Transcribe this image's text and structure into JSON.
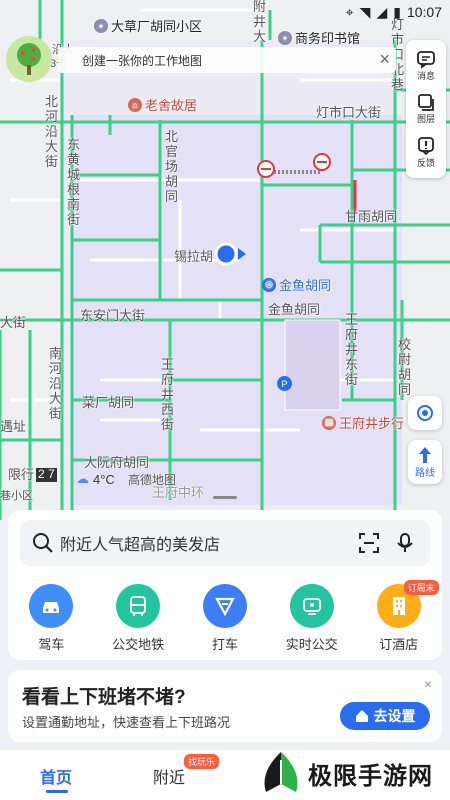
{
  "status": {
    "time": "10:07"
  },
  "banner": {
    "text": "创建一张你的工作地图",
    "close": "×"
  },
  "tools": [
    {
      "label": "消息",
      "icon": "message-icon"
    },
    {
      "label": "图层",
      "icon": "layers-icon"
    },
    {
      "label": "反馈",
      "icon": "feedback-icon"
    }
  ],
  "route_label": "路线",
  "map": {
    "labels": [
      {
        "text": "大草厂胡同小区",
        "kind": "poi"
      },
      {
        "text": "商务印书馆",
        "kind": "poi"
      },
      {
        "text": "老舍故居",
        "kind": "poi"
      },
      {
        "text": "金鱼胡同",
        "kind": "poi"
      },
      {
        "text": "王府井步行",
        "kind": "poi"
      },
      {
        "text": "灯市口大街"
      },
      {
        "text": "甘雨胡同"
      },
      {
        "text": "锡拉胡"
      },
      {
        "text": "东安门大街"
      },
      {
        "text": "金鱼胡同"
      },
      {
        "text": "菜厂胡同"
      },
      {
        "text": "大阮府胡同"
      },
      {
        "text": "王府中环"
      },
      {
        "text": "大街"
      },
      {
        "text": "限行"
      },
      {
        "text": "2 7"
      },
      {
        "text": "遇址"
      },
      {
        "text": "巷小区"
      },
      {
        "text": "北河沿大街"
      },
      {
        "text": "东黄城根南街"
      },
      {
        "text": "北官场胡同"
      },
      {
        "text": "南河沿大街"
      },
      {
        "text": "王府井西街"
      },
      {
        "text": "王府井东街"
      },
      {
        "text": "校尉胡同"
      },
      {
        "text": "灯市口北巷"
      },
      {
        "text": "附井大"
      },
      {
        "text": "沿大"
      },
      {
        "text": "3号"
      }
    ],
    "weather": {
      "temp": "4°C"
    },
    "watermark": "高德地图"
  },
  "search": {
    "placeholder": "附近人气超高的美发店"
  },
  "shortcuts": [
    {
      "label": "驾车",
      "color": "#3d8ef5",
      "icon": "car-icon"
    },
    {
      "label": "公交地铁",
      "color": "#23c4a0",
      "icon": "bus-icon"
    },
    {
      "label": "打车",
      "color": "#3d7ef5",
      "icon": "taxi-icon"
    },
    {
      "label": "实时公交",
      "color": "#23c4a0",
      "icon": "realtime-bus-icon"
    },
    {
      "label": "订酒店",
      "color": "#ffae1a",
      "icon": "hotel-icon",
      "badge": "订周末"
    }
  ],
  "commute": {
    "title": "看看上下班堵不堵?",
    "subtitle": "设置通勤地址，快速查看上下班路况",
    "button": "去设置",
    "close": "×"
  },
  "nav": {
    "home": "首页",
    "nearby": "附近",
    "nearby_badge": "找玩乐"
  },
  "brand": {
    "text": "极限手游网"
  },
  "colors": {
    "accent": "#2a6cf0",
    "road": "#2ec27e",
    "map_bg": "#eceaf4"
  }
}
